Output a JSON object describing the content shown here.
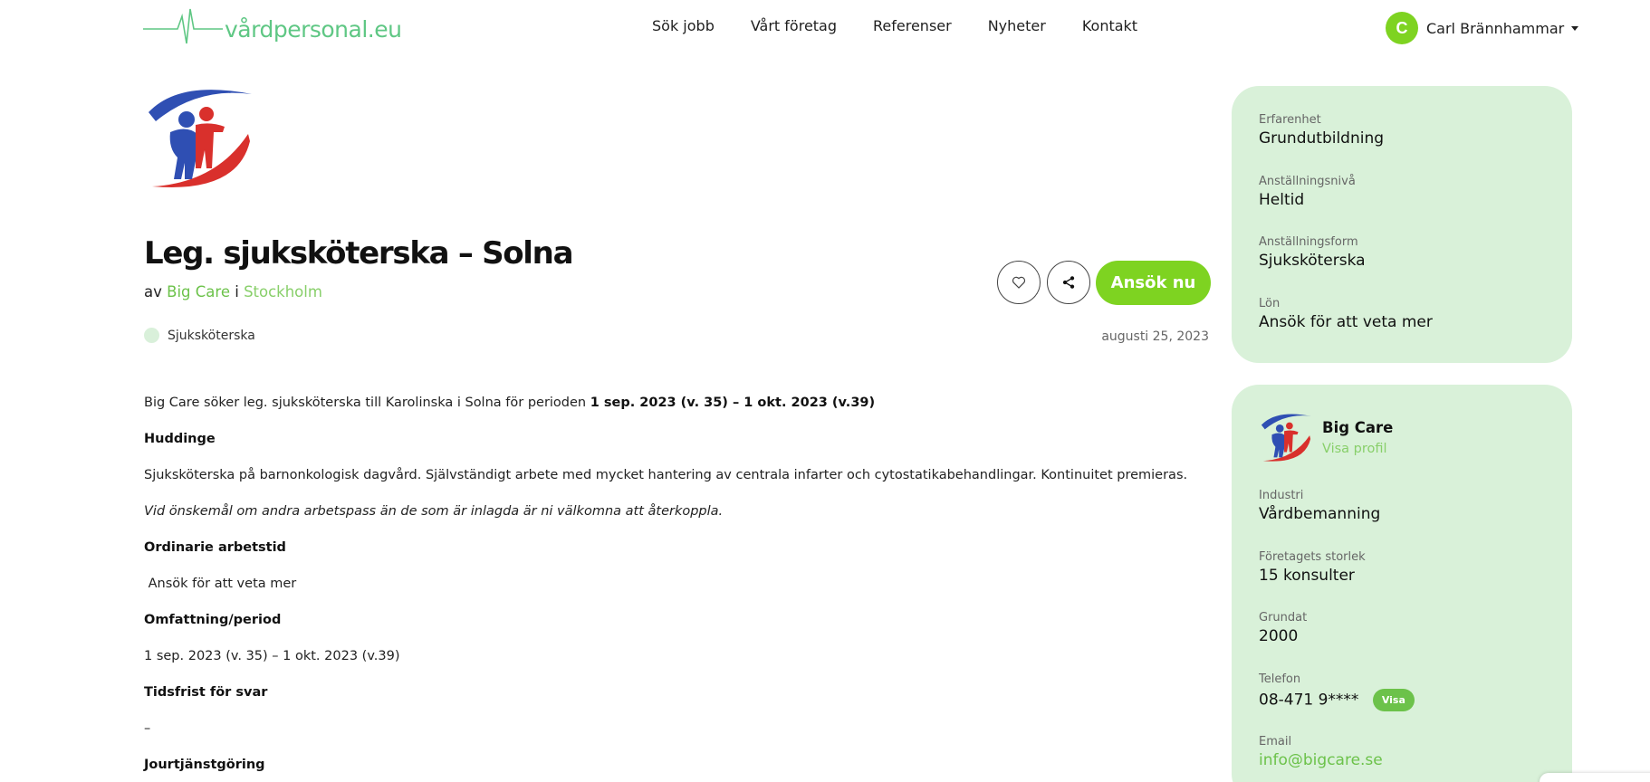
{
  "header": {
    "logo_text": "vårdpersonal.eu",
    "nav": [
      "Sök jobb",
      "Vårt företag",
      "Referenser",
      "Nyheter",
      "Kontakt"
    ],
    "user": {
      "initial": "C",
      "name": "Carl Brännhammar"
    }
  },
  "job": {
    "title": "Leg. sjuksköterska – Solna",
    "by_prefix": "av",
    "company": "Big Care",
    "in_word": "i",
    "location": "Stockholm",
    "category": "Sjuksköterska",
    "date": "augusti 25, 2023",
    "apply_label": "Ansök nu"
  },
  "description": {
    "intro": "Big Care söker leg. sjuksköterska till Karolinska i Solna för perioden ",
    "intro_bold": "1 sep. 2023 (v. 35) – 1 okt. 2023 (v.39)",
    "h_huddinge": "Huddinge",
    "p_huddinge": "Sjuksköterska på barnonkologisk dagvård. Självständigt arbete med mycket hantering av centrala infarter och cytostatikabehandlingar. Kontinuitet premieras.",
    "p_italic": "Vid önskemål om andra arbetspass än de som är inlagda är ni välkomna att återkoppla.",
    "h_arbetstid": "Ordinarie arbetstid",
    "p_arbetstid": " Ansök för att veta mer",
    "h_period": "Omfattning/period",
    "p_period": "1 sep. 2023 (v. 35) – 1 okt. 2023 (v.39)",
    "h_frist": "Tidsfrist för svar",
    "p_frist": "–",
    "h_jour": "Jourtjänstgöring"
  },
  "details": {
    "erfarenhet_label": "Erfarenhet",
    "erfarenhet": "Grundutbildning",
    "niva_label": "Anställningsnivå",
    "niva": "Heltid",
    "form_label": "Anställningsform",
    "form": "Sjuksköterska",
    "lon_label": "Lön",
    "lon": "Ansök för att veta mer"
  },
  "company": {
    "name": "Big Care",
    "profile_link": "Visa profil",
    "industri_label": "Industri",
    "industri": "Vårdbemanning",
    "storlek_label": "Företagets storlek",
    "storlek": "15 konsulter",
    "grundat_label": "Grundat",
    "grundat": "2000",
    "telefon_label": "Telefon",
    "telefon": "08-471 9****",
    "visa_label": "Visa",
    "email_label": "Email",
    "email": "info@bigcare.se"
  },
  "colors": {
    "accent": "#7ed321",
    "brand_text": "#5fc784",
    "card_bg": "#d9f1d9"
  },
  "icons": [
    "heartbeat-logo-icon",
    "heart-icon",
    "share-icon",
    "chevron-down-icon"
  ]
}
